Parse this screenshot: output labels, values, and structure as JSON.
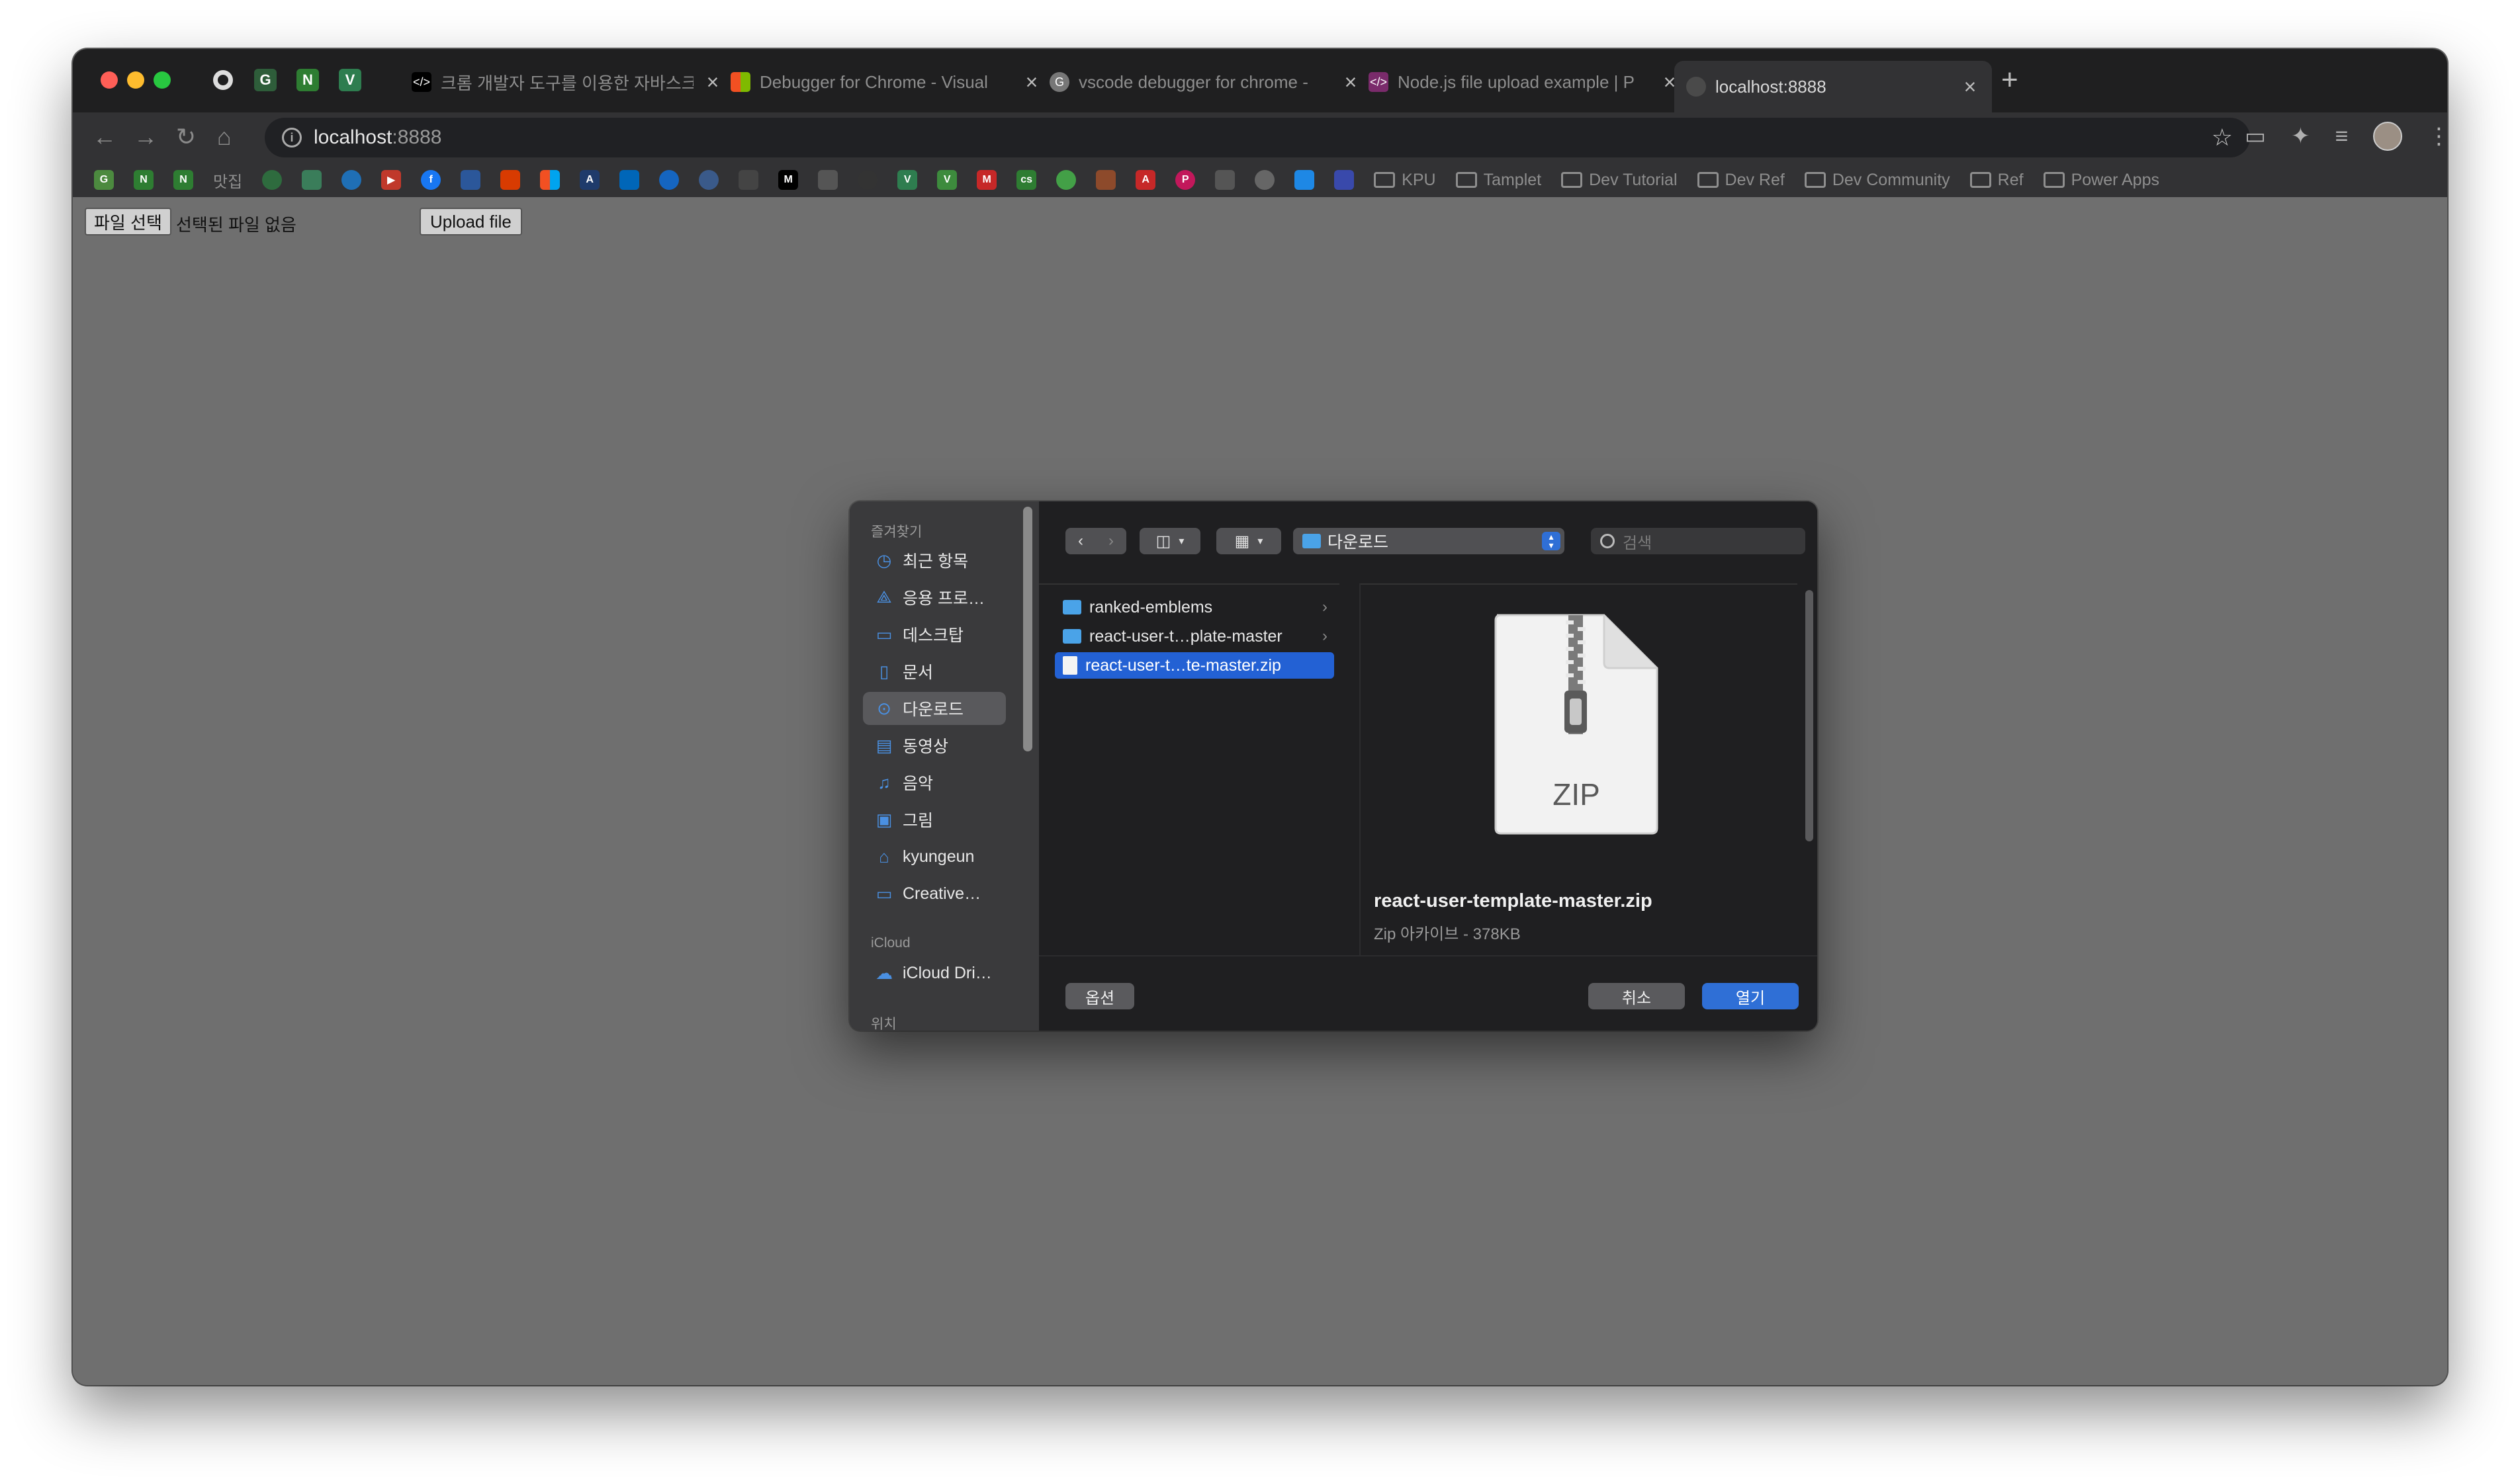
{
  "browser": {
    "tabs": [
      {
        "title": "크롬 개발자 도구를 이용한 자바스크립",
        "favicon": "code-icon"
      },
      {
        "title": "Debugger for Chrome - Visual",
        "favicon": "microsoft-icon"
      },
      {
        "title": "vscode debugger for chrome -",
        "favicon": "google-icon"
      },
      {
        "title": "Node.js file upload example | P",
        "favicon": "codepen-icon"
      },
      {
        "title": "localhost:8888",
        "favicon": "globe-icon",
        "active": true
      }
    ],
    "address": {
      "host": "localhost",
      "port": ":8888"
    },
    "bookmark_text": "맛집",
    "bookmark_folders": [
      "KPU",
      "Tamplet",
      "Dev Tutorial",
      "Dev Ref",
      "Dev Community",
      "Ref",
      "Power Apps"
    ]
  },
  "page": {
    "choose_file_label": "파일 선택",
    "no_file_text": "선택된 파일 없음",
    "upload_label": "Upload file"
  },
  "dialog": {
    "sidebar": {
      "favorites_header": "즐겨찾기",
      "favorites": [
        {
          "label": "최근 항목",
          "icon": "clock-icon"
        },
        {
          "label": "응용 프로…",
          "icon": "apps-icon"
        },
        {
          "label": "데스크탑",
          "icon": "desktop-icon"
        },
        {
          "label": "문서",
          "icon": "document-icon"
        },
        {
          "label": "다운로드",
          "icon": "download-icon",
          "selected": true
        },
        {
          "label": "동영상",
          "icon": "film-icon"
        },
        {
          "label": "음악",
          "icon": "music-icon"
        },
        {
          "label": "그림",
          "icon": "picture-icon"
        },
        {
          "label": "kyungeun",
          "icon": "home-icon"
        },
        {
          "label": "Creative…",
          "icon": "folder-icon"
        }
      ],
      "icloud_header": "iCloud",
      "icloud_items": [
        {
          "label": "iCloud Dri…",
          "icon": "cloud-icon"
        }
      ],
      "locations_header": "위치"
    },
    "current_folder": "다운로드",
    "search_placeholder": "검색",
    "files": [
      {
        "name": "ranked-emblems",
        "kind": "folder"
      },
      {
        "name": "react-user-t…plate-master",
        "kind": "folder"
      },
      {
        "name": "react-user-t…te-master.zip",
        "kind": "file",
        "selected": true
      }
    ],
    "preview": {
      "icon_label": "ZIP",
      "name": "react-user-template-master.zip",
      "meta": "Zip 아카이브 - 378KB"
    },
    "options_label": "옵션",
    "cancel_label": "취소",
    "open_label": "열기"
  },
  "colors": {
    "accent": "#2f6fd6",
    "folder": "#4aa3e8",
    "page_bg": "#6f6f6f"
  }
}
